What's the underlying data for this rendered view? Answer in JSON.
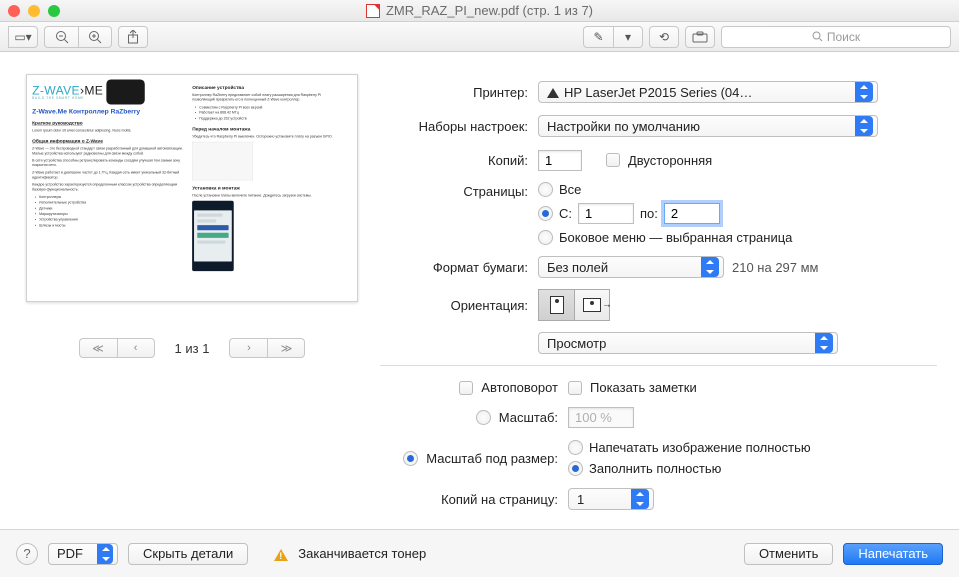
{
  "window": {
    "title": "ZMR_RAZ_PI_new.pdf (стр. 1 из 7)"
  },
  "toolbar": {
    "search_placeholder": "Поиск"
  },
  "preview": {
    "logo_brand": "Z-WAVE",
    "logo_suffix": "ME",
    "logo_tag": "BUILD THE SMART HOME",
    "doc_title": "Z-Wave.Me Контроллер RaZberry",
    "h_quick": "Краткое руководство",
    "h_info": "Общая информация о Z-Wave",
    "h_desc": "Описание устройства",
    "h_prep": "Перед началом монтажа",
    "h_inst": "Установка и монтаж"
  },
  "pager": {
    "label": "1 из 1"
  },
  "labels": {
    "printer": "Принтер:",
    "presets": "Наборы настроек:",
    "copies": "Копий:",
    "duplex": "Двусторонняя",
    "pages": "Страницы:",
    "all": "Все",
    "from": "С:",
    "to": "по:",
    "sidebar": "Боковое меню — выбранная страница",
    "paper": "Формат бумаги:",
    "papersize": "210 на 297 мм",
    "orient": "Ориентация:",
    "section": "Просмотр",
    "autorotate": "Автоповорот",
    "notes": "Показать заметки",
    "scale": "Масштаб:",
    "scalefit": "Масштаб под размер:",
    "printfull": "Напечатать изображение полностью",
    "fillfull": "Заполнить полностью",
    "cps": "Копий на страницу:"
  },
  "values": {
    "printer": "HP LaserJet P2015 Series (04…",
    "presets": "Настройки по умолчанию",
    "copies": "1",
    "from": "1",
    "to": "2",
    "paper": "Без полей",
    "scalepct": "100 %",
    "cps": "1"
  },
  "footer": {
    "pdf": "PDF",
    "hide": "Скрыть детали",
    "toner": "Заканчивается тонер",
    "cancel": "Отменить",
    "print": "Напечатать"
  }
}
